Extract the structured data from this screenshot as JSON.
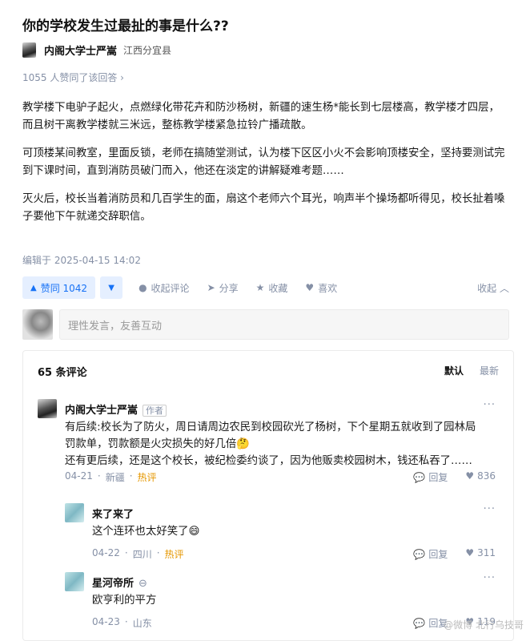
{
  "question": {
    "title": "你的学校发生过最扯的事是什么??"
  },
  "author": {
    "name": "内阁大学士严嵩",
    "location": "江西分宜县"
  },
  "upvote_note": "1055 人赞同了该回答 ›",
  "answer": {
    "paragraphs": [
      "教学楼下电驴子起火，点燃绿化带花卉和防沙杨树，新疆的速生杨*能长到七层楼高，教学楼才四层，而且树干离教学楼就三米远，整栋教学楼紧急拉铃广播疏散。",
      "可顶楼某间教室，里面反锁，老师在搞随堂测试，认为楼下区区小火不会影响顶楼安全，坚持要测试完到下课时间，直到消防员破门而入，他还在淡定的讲解疑难考题……",
      "灭火后，校长当着消防员和几百学生的面，扇这个老师六个耳光，响声半个操场都听得见，校长扯着嗓子要他下午就递交辞职信。"
    ]
  },
  "edited": "编辑于 2025-04-15 14:02",
  "actions": {
    "upvote": "赞同 1042",
    "collapse_comments": "收起评论",
    "share": "分享",
    "favorite": "收藏",
    "like": "喜欢",
    "collapse": "收起 ︿"
  },
  "comment_input": {
    "placeholder": "理性发言，友善互动"
  },
  "comments": {
    "count_label": "65 条评论",
    "sort_default": "默认",
    "sort_latest": "最新",
    "items": [
      {
        "name": "内阁大学士严嵩",
        "tag": "作者",
        "lines": [
          "有后续:校长为了防火，周日请周边农民到校园砍光了杨树，下个星期五就收到了园林局",
          "罚款单，罚款额是火灾损失的好几倍🤔",
          "还有更后续，还是这个校长，被纪检委约谈了，因为他贩卖校园树木，钱还私吞了……"
        ],
        "date": "04-21",
        "location": "新疆",
        "hot": "热评",
        "reply": "回复",
        "likes": "836"
      },
      {
        "name": "来了来了",
        "lines": [
          "这个连环也太好笑了😄"
        ],
        "date": "04-22",
        "location": "四川",
        "hot": "热评",
        "reply": "回复",
        "likes": "311"
      },
      {
        "name": "星河帝所",
        "lines": [
          "欧亨利的平方"
        ],
        "date": "04-23",
        "location": "山东",
        "reply": "回复",
        "likes": "119"
      }
    ]
  },
  "watermark": "@微博 北行乌技哥",
  "colors": {
    "accent": "#1772f6",
    "accent_bg": "#e5efff",
    "muted": "#8590a6",
    "hot": "#e59700"
  }
}
